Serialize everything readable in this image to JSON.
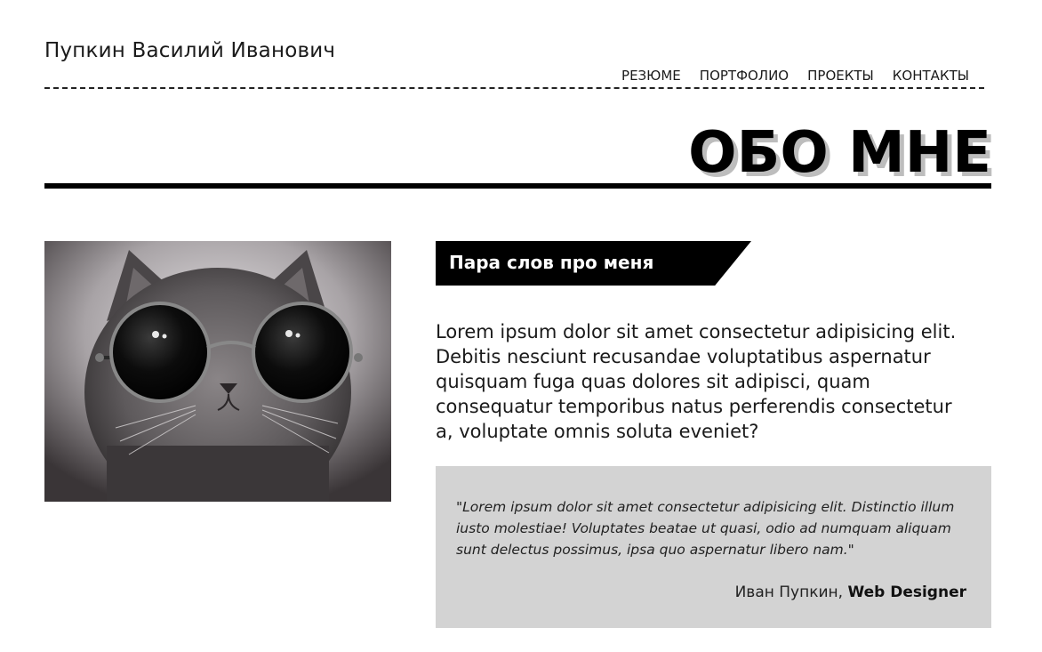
{
  "header": {
    "site_name": "Пупкин Василий Иванович",
    "nav": [
      {
        "label": "РЕЗЮМЕ"
      },
      {
        "label": "ПОРТФОЛИО"
      },
      {
        "label": "ПРОЕКТЫ"
      },
      {
        "label": "КОНТАКТЫ"
      }
    ]
  },
  "section": {
    "title": "ОБО МНЕ"
  },
  "photo": {
    "alt": "Cat wearing round sunglasses",
    "icon": "cat-photo"
  },
  "about": {
    "subheading": "Пара слов про меня",
    "text": "Lorem ipsum dolor sit amet consectetur adipisicing elit. Debitis nesciunt recusandae voluptatibus aspernatur quisquam fuga quas dolores sit adipisci, quam consequatur temporibus natus perferendis consectetur a, voluptate omnis soluta eveniet?"
  },
  "quote": {
    "text": "\"Lorem ipsum dolor sit amet consectetur adipisicing elit. Distinctio illum iusto molestiae! Voluptates beatae ut quasi, odio ad numquam aliquam sunt delectus possimus, ipsa quo aspernatur libero nam.\"",
    "author_name": "Иван Пупкин,",
    "author_role": "Web Designer",
    "background": "#d3d3d3"
  },
  "colors": {
    "accent": "#000000",
    "title_shadow": "#bdbdbd"
  }
}
